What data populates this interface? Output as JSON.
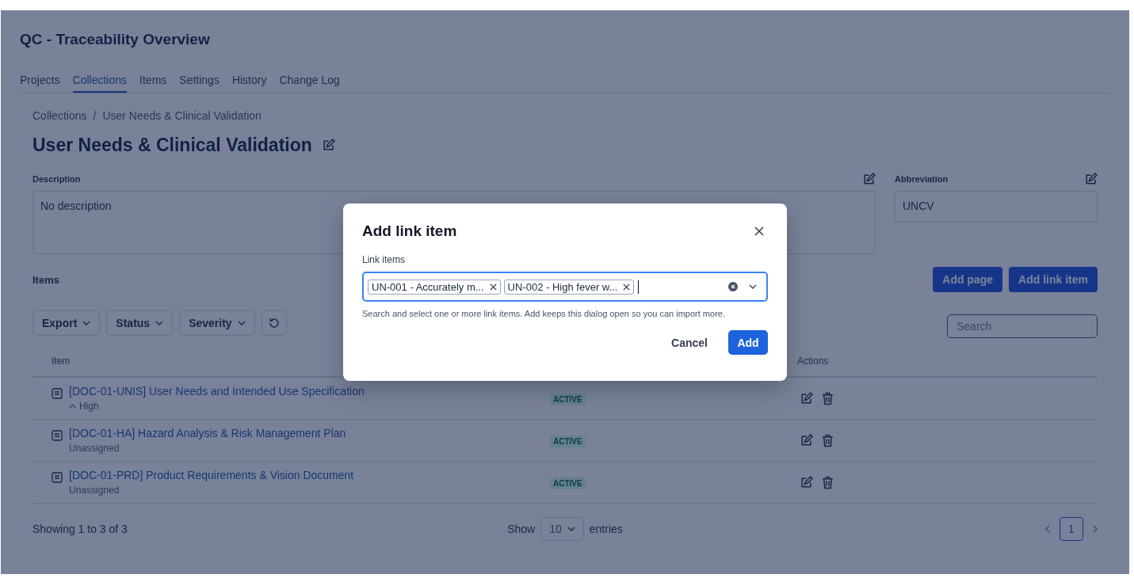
{
  "app_title": "QC - Traceability Overview",
  "tabs": [
    {
      "label": "Projects",
      "selected": false
    },
    {
      "label": "Collections",
      "selected": true
    },
    {
      "label": "Items",
      "selected": false
    },
    {
      "label": "Settings",
      "selected": false
    },
    {
      "label": "History",
      "selected": false
    },
    {
      "label": "Change Log",
      "selected": false
    }
  ],
  "breadcrumb": [
    "Collections",
    "User Needs & Clinical Validation"
  ],
  "breadcrumb_separator": "/",
  "page_title": "User Needs & Clinical Validation",
  "description": {
    "label": "Description",
    "value": "No description"
  },
  "abbreviation": {
    "label": "Abbreviation",
    "value": "UNCV"
  },
  "items_section": {
    "title": "Items",
    "buttons": [
      "Add page",
      "Add link item"
    ],
    "filters": [
      "Export",
      "Status",
      "Severity"
    ],
    "search_placeholder": "Search"
  },
  "table": {
    "columns": [
      "Item",
      "Actions"
    ],
    "rows": [
      {
        "title": "[DOC-01-UNIS] User Needs and Intended Use Specification",
        "kind": "priority",
        "subtitle": "High",
        "status": "ACTIVE"
      },
      {
        "title": "[DOC-01-HA] Hazard Analysis & Risk Management Plan",
        "kind": "plain",
        "subtitle": "Unassigned",
        "status": "ACTIVE"
      },
      {
        "title": "[DOC-01-PRD] Product Requirements & Vision Document",
        "kind": "plain",
        "subtitle": "Unassigned",
        "status": "ACTIVE"
      }
    ]
  },
  "footer": {
    "showing": "Showing 1 to 3 of 3",
    "show_label": "Show",
    "page_size": "10",
    "entries_label": "entries",
    "pages": [
      {
        "label": "1",
        "selected": true
      }
    ]
  },
  "dialog": {
    "title": "Add link item",
    "field_label": "Link items",
    "tags": [
      "UN-001 - Accurately m...",
      "UN-002 - High fever w..."
    ],
    "help": "Search and select one or more link items. Add keeps this dialog open so you can import more.",
    "cancel": "Cancel",
    "add": "Add"
  }
}
